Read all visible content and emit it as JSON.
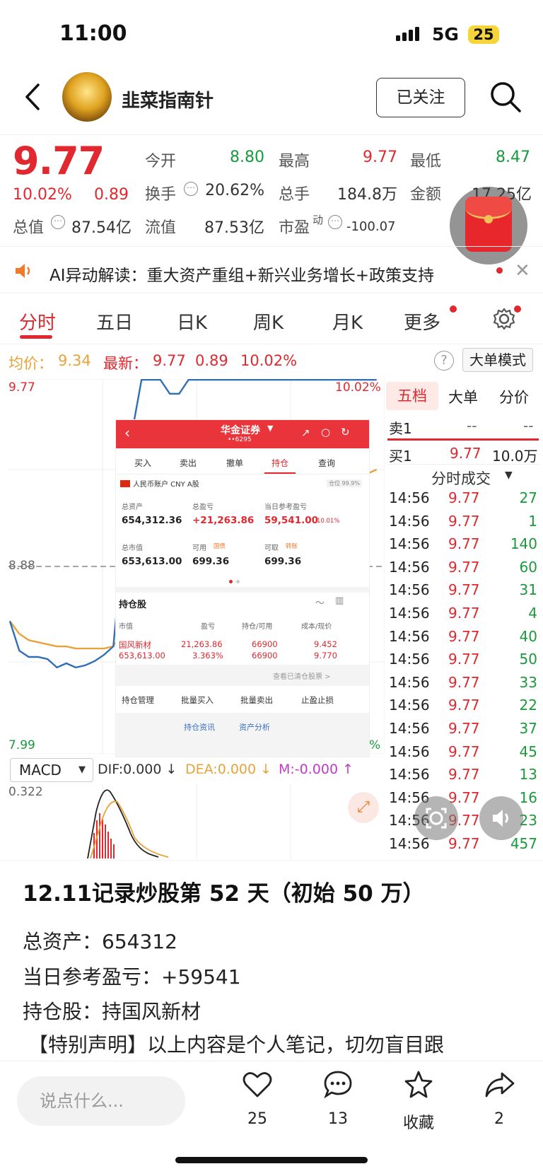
{
  "status_bar": {
    "time": "11:00",
    "network": "5G",
    "battery": "25"
  },
  "header": {
    "author": "韭菜指南针",
    "follow_label": "已关注"
  },
  "quote": {
    "price": "9.77",
    "change_pct": "10.02%",
    "change": "0.89",
    "open_label": "今开",
    "open": "8.80",
    "high_label": "最高",
    "high": "9.77",
    "low_label": "最低",
    "low": "8.47",
    "turnover_label": "换手",
    "turnover": "20.62%",
    "volume_label": "总手",
    "volume": "184.8万",
    "amount_label": "金额",
    "amount": "17.25亿",
    "mktcap_label": "总值",
    "mktcap": "87.54亿",
    "float_label": "流值",
    "float": "87.53亿",
    "pe_label": "市盈",
    "pe_sup": "动",
    "pe": "-100.07"
  },
  "ai_bar": {
    "text": "AI异动解读：重大资产重组+新兴业务增长+政策支持"
  },
  "tabs": [
    "分时",
    "五日",
    "日K",
    "周K",
    "月K",
    "更多"
  ],
  "info_line": {
    "avg_label": "均价：",
    "avg": "9.34",
    "latest_label": "最新：",
    "latest": "9.77",
    "chg": "0.89",
    "pct": "10.02%",
    "mode_label": "大单模式",
    "help": "?"
  },
  "chart": {
    "top_label": "9.77",
    "top_pct": "10.02%",
    "mid_label": "8.88",
    "bottom_label": "7.99",
    "bottom_pct": "%"
  },
  "order_book": {
    "tabs": [
      "五档",
      "大单",
      "分价"
    ],
    "sell1_label": "卖1",
    "sell1_price": "--",
    "sell1_vol": "--",
    "buy1_label": "买1",
    "buy1_price": "9.77",
    "buy1_vol": "10.0万",
    "trades_title": "分时成交",
    "trades": [
      [
        "14:56",
        "9.77",
        "27"
      ],
      [
        "14:56",
        "9.77",
        "1"
      ],
      [
        "14:56",
        "9.77",
        "140"
      ],
      [
        "14:56",
        "9.77",
        "60"
      ],
      [
        "14:56",
        "9.77",
        "31"
      ],
      [
        "14:56",
        "9.77",
        "4"
      ],
      [
        "14:56",
        "9.77",
        "40"
      ],
      [
        "14:56",
        "9.77",
        "50"
      ],
      [
        "14:56",
        "9.77",
        "33"
      ],
      [
        "14:56",
        "9.77",
        "22"
      ],
      [
        "14:56",
        "9.77",
        "37"
      ],
      [
        "14:56",
        "9.77",
        "45"
      ],
      [
        "14:56",
        "9.77",
        "13"
      ],
      [
        "14:56",
        "9.77",
        "16"
      ],
      [
        "14:56",
        "9.77",
        "23"
      ],
      [
        "14:56",
        "9.77",
        "457"
      ]
    ]
  },
  "macd": {
    "selector": "MACD",
    "dif": "DIF:0.000 ↓",
    "dea": "DEA:0.000 ↓",
    "m": "M:-0.000 ↑",
    "scale": "0.322"
  },
  "overlay": {
    "broker": "华金证券",
    "account": "••6295",
    "tabs": [
      "买入",
      "卖出",
      "撤单",
      "持仓",
      "查询"
    ],
    "account_type": "人民币账户 CNY A股",
    "position_ratio": "仓位 99.9%",
    "total_assets_label": "总资产",
    "total_assets": "654,312.36",
    "total_pnl_label": "总盈亏",
    "total_pnl": "+21,263.86",
    "day_pnl_label": "当日参考盈亏",
    "day_pnl": "59,541.00",
    "day_pnl_pct": "10.01%",
    "mkt_value_label": "总市值",
    "mkt_value": "653,613.00",
    "available_label": "可用",
    "available_tag": "国债",
    "available": "699.36",
    "withdrawable_label": "可取",
    "withdrawable_tag": "转账",
    "withdrawable": "699.36",
    "holdings_title": "持仓股",
    "col_headers": [
      "市值",
      "盈亏",
      "持仓/可用",
      "成本/现价"
    ],
    "holding": {
      "name": "国风新材",
      "value": "653,613.00",
      "pnl": "21,263.86",
      "pnl_pct": "3.363%",
      "pos": "66900",
      "avail": "66900",
      "cost": "9.452",
      "now": "9.770"
    },
    "cleared_link": "查看已清仓股票 >",
    "actions": [
      "持仓管理",
      "批量买入",
      "批量卖出",
      "止盈止损"
    ],
    "bottom_tabs": [
      "持仓资讯",
      "资产分析"
    ]
  },
  "post": {
    "title": "12.11记录炒股第 52 天（初始 50 万）",
    "lines": [
      "总资产：654312",
      "当日参考盈亏：+59541",
      "持仓股：持国风新材",
      "【特别声明】以上内容是个人笔记，切勿盲目跟"
    ]
  },
  "bottom_bar": {
    "placeholder": "说点什么...",
    "likes": "25",
    "comments": "13",
    "favorite_label": "收藏",
    "shares": "2"
  },
  "colors": {
    "up": "#e0282e",
    "down": "#1a9a3c",
    "avg_line": "#e8a33a",
    "price_line": "#2f6fb5"
  },
  "chart_data": {
    "type": "line",
    "title": "",
    "ylim": [
      7.99,
      9.77
    ],
    "reference": 8.88,
    "series": [
      {
        "values": [
          8.62,
          8.48,
          8.45,
          8.45,
          8.44,
          8.4,
          8.42,
          8.4,
          8.41,
          8.43,
          8.46,
          8.5,
          8.98,
          9.52,
          9.77,
          9.77,
          9.77,
          9.7,
          9.7,
          9.77,
          9.77,
          9.77,
          9.77,
          9.77,
          9.77,
          9.77,
          9.77,
          9.77,
          9.77,
          9.77,
          9.77,
          9.77,
          9.77,
          9.77,
          9.77,
          9.77,
          9.77,
          9.77,
          9.77,
          9.77
        ]
      },
      {
        "values": [
          8.62,
          8.56,
          8.53,
          8.52,
          8.51,
          8.5,
          8.5,
          8.49,
          8.49,
          8.49,
          8.49,
          8.5,
          8.58,
          8.85,
          8.98,
          9.0,
          9.02,
          9.04,
          9.06,
          9.08,
          9.1,
          9.12,
          9.14,
          9.16,
          9.18,
          9.19,
          9.2,
          9.21,
          9.22,
          9.23,
          9.24,
          9.25,
          9.26,
          9.27,
          9.28,
          9.29,
          9.3,
          9.31,
          9.32,
          9.34
        ]
      }
    ]
  }
}
